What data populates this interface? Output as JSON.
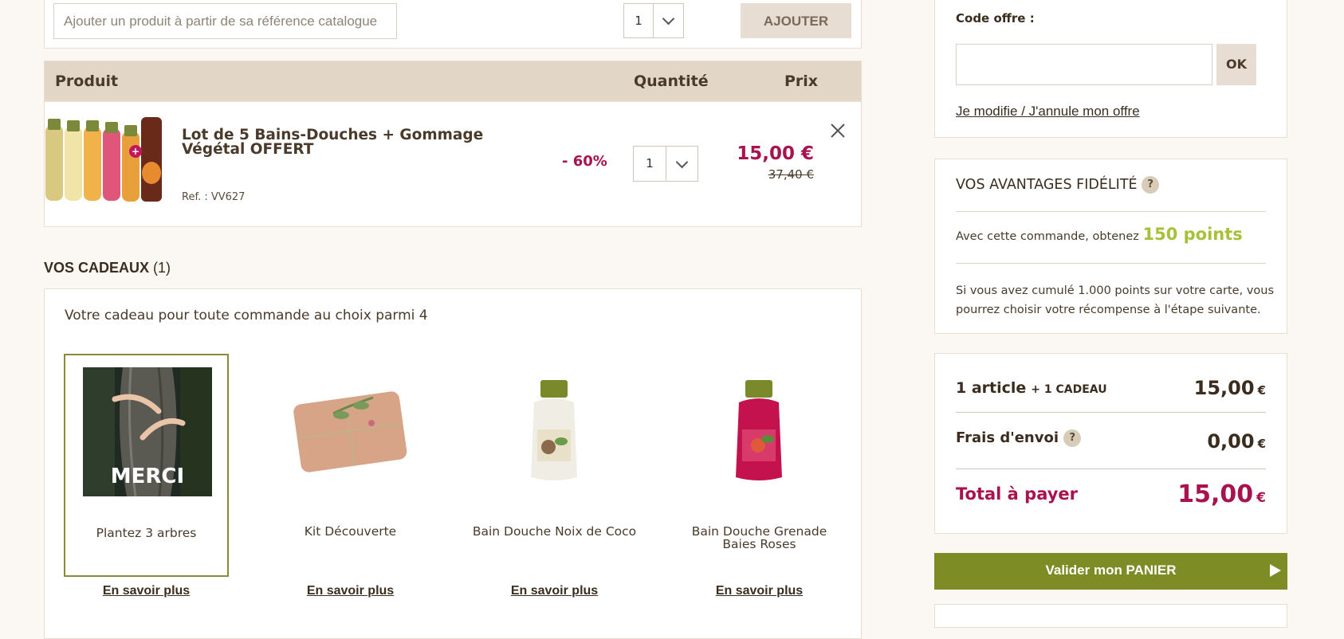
{
  "add_by_ref": {
    "placeholder": "Ajouter un produit à partir de sa référence catalogue",
    "qty": "1",
    "button": "AJOUTER"
  },
  "cart": {
    "headers": {
      "product": "Produit",
      "quantity": "Quantité",
      "price": "Prix"
    },
    "item": {
      "name": "Lot de 5 Bains-Douches + Gommage Végétal OFFERT",
      "ref": "Ref. : VV627",
      "discount": "- 60%",
      "qty": "1",
      "price_now": "15,00 €",
      "price_old": "37,40 €"
    }
  },
  "gifts": {
    "title": "VOS CADEAUX",
    "count": "(1)",
    "intro": "Votre cadeau pour toute commande au choix parmi 4",
    "items": [
      {
        "name": "Plantez 3 arbres",
        "image_text": "MERCI",
        "selected": true
      },
      {
        "name": "Kit Découverte",
        "selected": false
      },
      {
        "name": "Bain Douche Noix de Coco",
        "selected": false
      },
      {
        "name": "Bain Douche Grenade Baies Roses",
        "selected": false
      }
    ],
    "more_label": "En savoir plus"
  },
  "offer": {
    "label": "Code offre :",
    "ok": "OK",
    "link": "Je modifie / J'annule mon offre"
  },
  "loyalty": {
    "title": "VOS AVANTAGES FIDÉLITÉ",
    "help": "?",
    "text": "Avec cette commande, obtenez",
    "points": "150 points",
    "note": "Si vous avez cumulé 1.000 points sur votre carte, vous pourrez choisir votre récompense à l'étape suivante."
  },
  "summary": {
    "articles": "1 article",
    "gift_note": "+ 1 CADEAU",
    "subtotal": "15,00",
    "shipping_label": "Frais d'envoi",
    "shipping": "0,00",
    "total_label": "Total à payer",
    "total": "15,00",
    "currency": "€"
  },
  "validate_button": "Valider mon PANIER",
  "colors": {
    "accent": "#a8124f",
    "green": "#7e8c25",
    "points": "#a7c03a",
    "header_bg": "#e2d7c6",
    "page_bg": "#fbf7f3"
  }
}
